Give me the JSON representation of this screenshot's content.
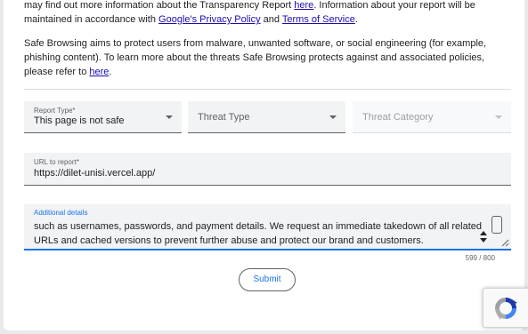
{
  "paragraph1": {
    "text_a": "may find out more information about the Transparency Report ",
    "link_here": "here",
    "text_b": ". Information about your report will be maintained in accordance with ",
    "link_privacy": "Google's Privacy Policy",
    "text_and": " and ",
    "link_terms": "Terms of Service",
    "text_end": "."
  },
  "paragraph2": {
    "text": "Safe Browsing aims to protect users from malware, unwanted software, or social engineering (for example, phishing content). To learn more about the threats Safe Browsing protects against and associated policies, please refer to ",
    "link_here": "here",
    "text_end": "."
  },
  "report_type": {
    "label": "Report Type*",
    "value": "This page is not safe"
  },
  "threat_type": {
    "placeholder": "Threat Type"
  },
  "threat_category": {
    "placeholder": "Threat Category"
  },
  "url_field": {
    "label": "URL to report*",
    "value": "https://dilet-unisi.vercel.app/"
  },
  "details_field": {
    "label": "Additional details",
    "value": "such as usernames, passwords, and payment details. We request an immediate takedown of all related URLs and cached versions to prevent further abuse and protect our brand and customers."
  },
  "char_counter": "599 / 800",
  "submit_label": "Submit",
  "colors": {
    "accent": "#1a73e8",
    "link": "#1a0dab"
  },
  "icons": [
    "dropdown-caret-icon",
    "spinner-icon",
    "resize-handle-icon",
    "recaptcha-logo-icon"
  ]
}
